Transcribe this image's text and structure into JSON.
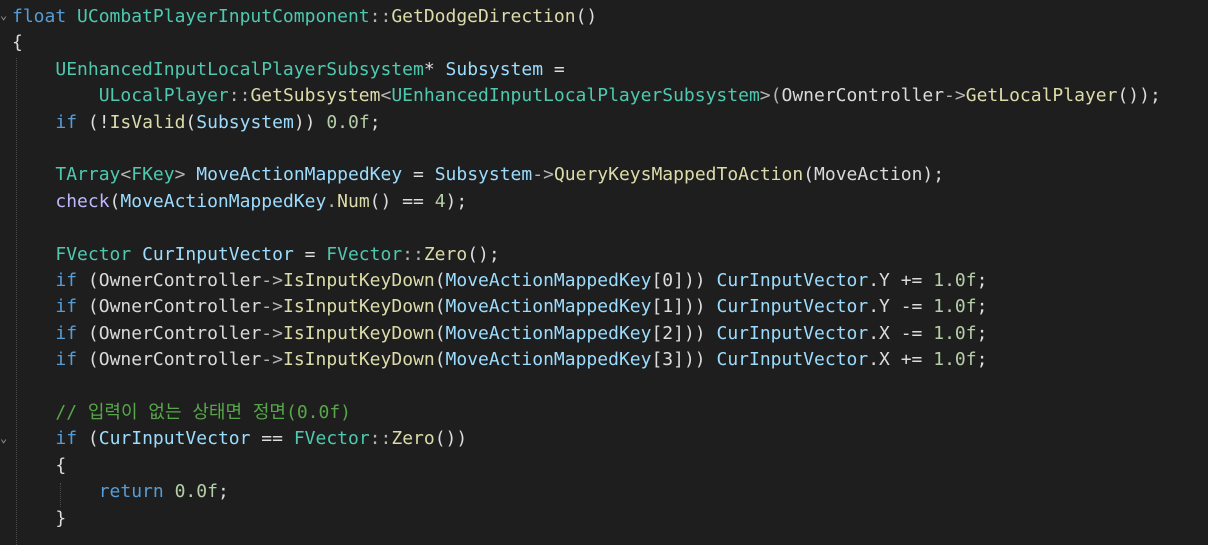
{
  "editor": {
    "language": "cpp",
    "colors": {
      "background": "#1e1e1e",
      "keyword": "#569cd6",
      "type": "#4ec9b0",
      "function": "#dcdcaa",
      "variable": "#9cdcfe",
      "macro": "#beb7ff",
      "number": "#b5cea8",
      "comment": "#57a64a",
      "plain": "#dcdcdc"
    },
    "lines": [
      [
        {
          "t": "float",
          "c": "kw"
        },
        {
          "t": " ",
          "c": "plain"
        },
        {
          "t": "UCombatPlayerInputComponent",
          "c": "type"
        },
        {
          "t": "::",
          "c": "punct"
        },
        {
          "t": "GetDodgeDirection",
          "c": "func"
        },
        {
          "t": "()",
          "c": "plain"
        }
      ],
      [
        {
          "t": "{",
          "c": "plain"
        }
      ],
      [
        {
          "t": "    ",
          "c": "plain"
        },
        {
          "t": "UEnhancedInputLocalPlayerSubsystem",
          "c": "type"
        },
        {
          "t": "* ",
          "c": "plain"
        },
        {
          "t": "Subsystem",
          "c": "var"
        },
        {
          "t": " =",
          "c": "plain"
        }
      ],
      [
        {
          "t": "        ",
          "c": "plain"
        },
        {
          "t": "ULocalPlayer",
          "c": "type"
        },
        {
          "t": "::",
          "c": "punct"
        },
        {
          "t": "GetSubsystem",
          "c": "func"
        },
        {
          "t": "<",
          "c": "punct"
        },
        {
          "t": "UEnhancedInputLocalPlayerSubsystem",
          "c": "type"
        },
        {
          "t": ">(",
          "c": "punct"
        },
        {
          "t": "OwnerController",
          "c": "member"
        },
        {
          "t": "->",
          "c": "punct"
        },
        {
          "t": "GetLocalPlayer",
          "c": "func"
        },
        {
          "t": "());",
          "c": "plain"
        }
      ],
      [
        {
          "t": "    ",
          "c": "plain"
        },
        {
          "t": "if",
          "c": "kw"
        },
        {
          "t": " (!",
          "c": "plain"
        },
        {
          "t": "IsValid",
          "c": "func"
        },
        {
          "t": "(",
          "c": "plain"
        },
        {
          "t": "Subsystem",
          "c": "var"
        },
        {
          "t": ")) ",
          "c": "plain"
        },
        {
          "t": "0.0f",
          "c": "num"
        },
        {
          "t": ";",
          "c": "plain"
        }
      ],
      [],
      [
        {
          "t": "    ",
          "c": "plain"
        },
        {
          "t": "TArray",
          "c": "type"
        },
        {
          "t": "<",
          "c": "punct"
        },
        {
          "t": "FKey",
          "c": "type"
        },
        {
          "t": "> ",
          "c": "punct"
        },
        {
          "t": "MoveActionMappedKey",
          "c": "var"
        },
        {
          "t": " = ",
          "c": "plain"
        },
        {
          "t": "Subsystem",
          "c": "var"
        },
        {
          "t": "->",
          "c": "punct"
        },
        {
          "t": "QueryKeysMappedToAction",
          "c": "func"
        },
        {
          "t": "(",
          "c": "plain"
        },
        {
          "t": "MoveAction",
          "c": "member"
        },
        {
          "t": ");",
          "c": "plain"
        }
      ],
      [
        {
          "t": "    ",
          "c": "plain"
        },
        {
          "t": "check",
          "c": "macro"
        },
        {
          "t": "(",
          "c": "plain"
        },
        {
          "t": "MoveActionMappedKey",
          "c": "var"
        },
        {
          "t": ".",
          "c": "punct"
        },
        {
          "t": "Num",
          "c": "func"
        },
        {
          "t": "() == ",
          "c": "plain"
        },
        {
          "t": "4",
          "c": "num"
        },
        {
          "t": ");",
          "c": "plain"
        }
      ],
      [],
      [
        {
          "t": "    ",
          "c": "plain"
        },
        {
          "t": "FVector",
          "c": "type"
        },
        {
          "t": " ",
          "c": "plain"
        },
        {
          "t": "CurInputVector",
          "c": "var"
        },
        {
          "t": " = ",
          "c": "plain"
        },
        {
          "t": "FVector",
          "c": "type"
        },
        {
          "t": "::",
          "c": "punct"
        },
        {
          "t": "Zero",
          "c": "func"
        },
        {
          "t": "();",
          "c": "plain"
        }
      ],
      [
        {
          "t": "    ",
          "c": "plain"
        },
        {
          "t": "if",
          "c": "kw"
        },
        {
          "t": " (",
          "c": "plain"
        },
        {
          "t": "OwnerController",
          "c": "member"
        },
        {
          "t": "->",
          "c": "punct"
        },
        {
          "t": "IsInputKeyDown",
          "c": "func"
        },
        {
          "t": "(",
          "c": "plain"
        },
        {
          "t": "MoveActionMappedKey",
          "c": "var"
        },
        {
          "t": "[0])) ",
          "c": "plain"
        },
        {
          "t": "CurInputVector",
          "c": "var"
        },
        {
          "t": ".Y += ",
          "c": "plain"
        },
        {
          "t": "1.0f",
          "c": "num"
        },
        {
          "t": ";",
          "c": "plain"
        }
      ],
      [
        {
          "t": "    ",
          "c": "plain"
        },
        {
          "t": "if",
          "c": "kw"
        },
        {
          "t": " (",
          "c": "plain"
        },
        {
          "t": "OwnerController",
          "c": "member"
        },
        {
          "t": "->",
          "c": "punct"
        },
        {
          "t": "IsInputKeyDown",
          "c": "func"
        },
        {
          "t": "(",
          "c": "plain"
        },
        {
          "t": "MoveActionMappedKey",
          "c": "var"
        },
        {
          "t": "[1])) ",
          "c": "plain"
        },
        {
          "t": "CurInputVector",
          "c": "var"
        },
        {
          "t": ".Y -= ",
          "c": "plain"
        },
        {
          "t": "1.0f",
          "c": "num"
        },
        {
          "t": ";",
          "c": "plain"
        }
      ],
      [
        {
          "t": "    ",
          "c": "plain"
        },
        {
          "t": "if",
          "c": "kw"
        },
        {
          "t": " (",
          "c": "plain"
        },
        {
          "t": "OwnerController",
          "c": "member"
        },
        {
          "t": "->",
          "c": "punct"
        },
        {
          "t": "IsInputKeyDown",
          "c": "func"
        },
        {
          "t": "(",
          "c": "plain"
        },
        {
          "t": "MoveActionMappedKey",
          "c": "var"
        },
        {
          "t": "[2])) ",
          "c": "plain"
        },
        {
          "t": "CurInputVector",
          "c": "var"
        },
        {
          "t": ".X -= ",
          "c": "plain"
        },
        {
          "t": "1.0f",
          "c": "num"
        },
        {
          "t": ";",
          "c": "plain"
        }
      ],
      [
        {
          "t": "    ",
          "c": "plain"
        },
        {
          "t": "if",
          "c": "kw"
        },
        {
          "t": " (",
          "c": "plain"
        },
        {
          "t": "OwnerController",
          "c": "member"
        },
        {
          "t": "->",
          "c": "punct"
        },
        {
          "t": "IsInputKeyDown",
          "c": "func"
        },
        {
          "t": "(",
          "c": "plain"
        },
        {
          "t": "MoveActionMappedKey",
          "c": "var"
        },
        {
          "t": "[3])) ",
          "c": "plain"
        },
        {
          "t": "CurInputVector",
          "c": "var"
        },
        {
          "t": ".X += ",
          "c": "plain"
        },
        {
          "t": "1.0f",
          "c": "num"
        },
        {
          "t": ";",
          "c": "plain"
        }
      ],
      [],
      [
        {
          "t": "    ",
          "c": "plain"
        },
        {
          "t": "// 입력이 없는 상태면 정면(0.0f)",
          "c": "comment"
        }
      ],
      [
        {
          "t": "    ",
          "c": "plain"
        },
        {
          "t": "if",
          "c": "kw"
        },
        {
          "t": " (",
          "c": "plain"
        },
        {
          "t": "CurInputVector",
          "c": "var"
        },
        {
          "t": " == ",
          "c": "plain"
        },
        {
          "t": "FVector",
          "c": "type"
        },
        {
          "t": "::",
          "c": "punct"
        },
        {
          "t": "Zero",
          "c": "func"
        },
        {
          "t": "())",
          "c": "plain"
        }
      ],
      [
        {
          "t": "    {",
          "c": "plain"
        }
      ],
      [
        {
          "t": "        ",
          "c": "plain"
        },
        {
          "t": "return",
          "c": "kw"
        },
        {
          "t": " ",
          "c": "plain"
        },
        {
          "t": "0.0f",
          "c": "num"
        },
        {
          "t": ";",
          "c": "plain"
        }
      ],
      [
        {
          "t": "    }",
          "c": "plain"
        }
      ],
      []
    ]
  }
}
